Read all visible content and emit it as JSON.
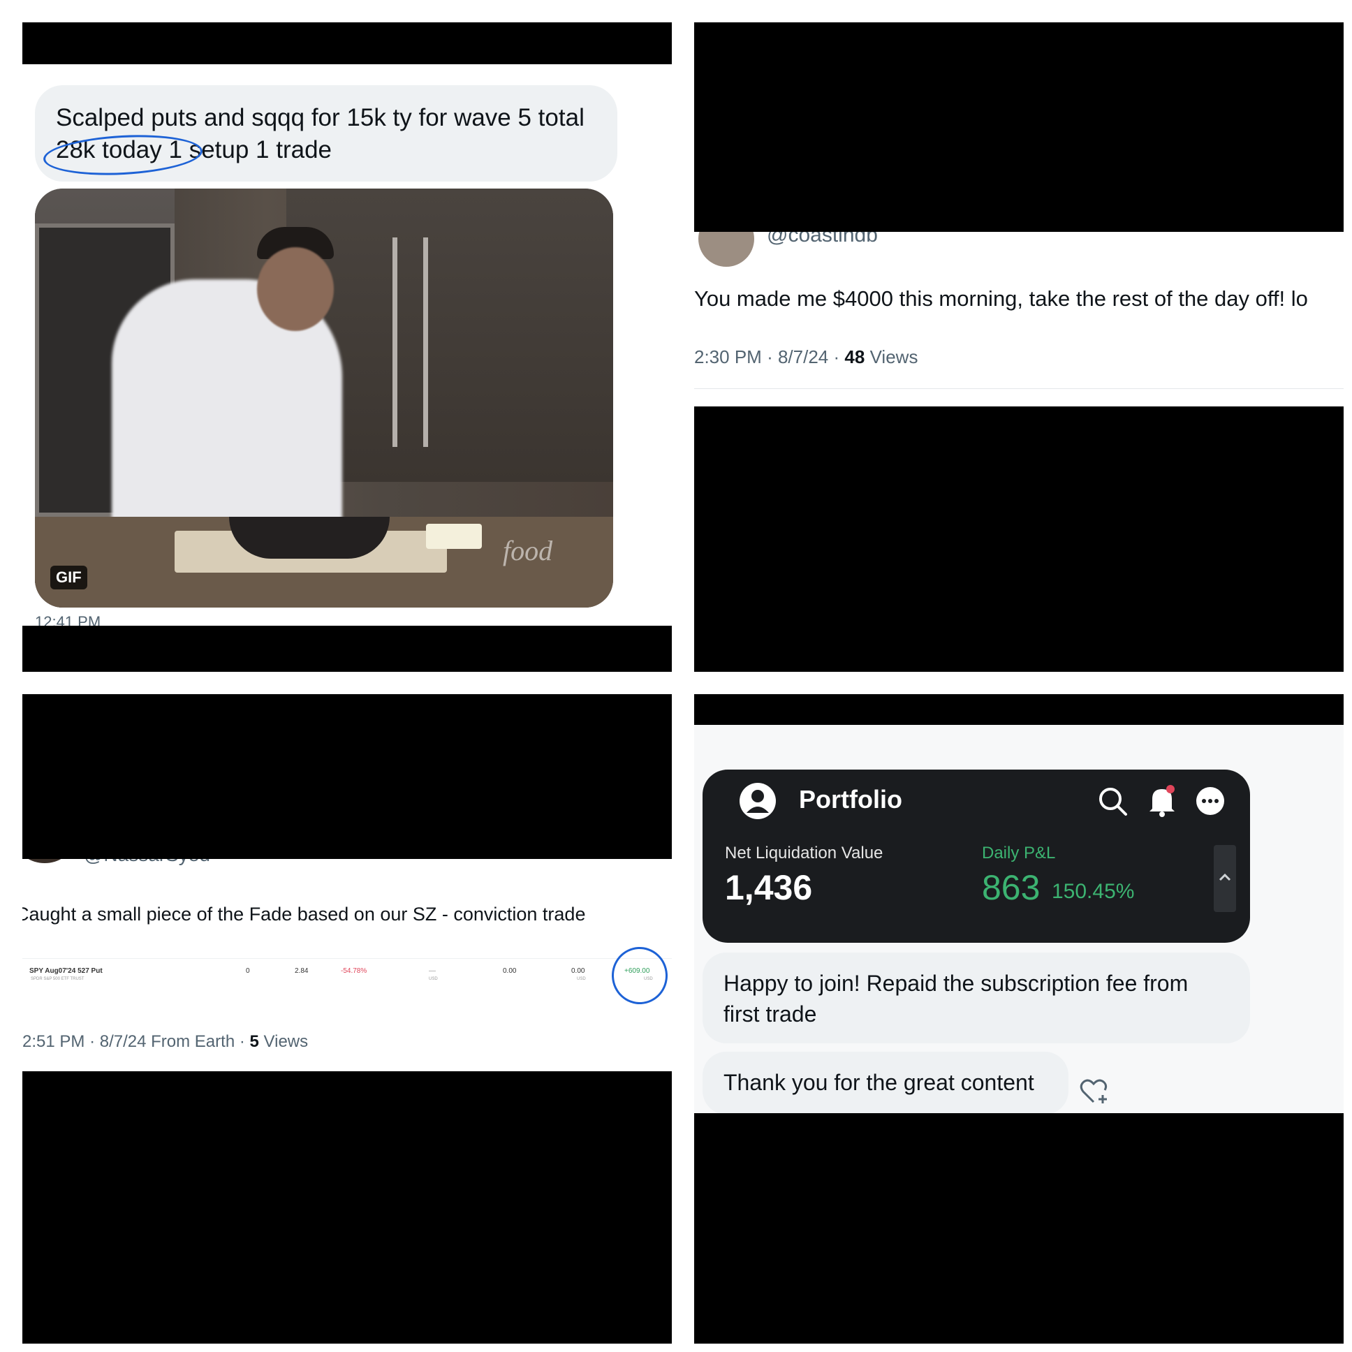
{
  "panel_1": {
    "message": {
      "line_1": "Scalped puts and sqqq for 15k ty for wave 5 total",
      "line_2": "28k today 1 setup 1 trade"
    },
    "gif": {
      "badge": "GIF",
      "watermark": "food"
    },
    "timestamp_partial": "12:41 PM"
  },
  "panel_2": {
    "handle_partial": "@coastindb",
    "reply_text": "You made me $4000 this morning, take the rest of the day off! lo",
    "time": "2:30 PM",
    "date": "8/7/24",
    "separator": "·",
    "views_count": "48",
    "views_label": "Views"
  },
  "panel_3": {
    "handle_partial": "@NassarSyed",
    "post_text": "Caught a small piece of the Fade based on our SZ - conviction trade",
    "position": {
      "symbol": "SPY Aug07'24 527 Put",
      "description": "SPDR S&P 500 ETF TRUST",
      "qty": "0",
      "price": "2.84",
      "change": "-54.78%",
      "col_dash": "—",
      "col_dash_unit": "USD",
      "col_a": "0.00",
      "col_b": "0.00",
      "col_b_unit": "USD",
      "pnl": "+609.00",
      "pnl_unit": "USD"
    },
    "time": "2:51 PM",
    "date": "8/7/24",
    "source": "From Earth",
    "separator": "·",
    "views_count": "5",
    "views_label": "Views"
  },
  "panel_4": {
    "app": {
      "title": "Portfolio",
      "net_liquidation_label": "Net Liquidation Value",
      "net_liquidation_value": "1,436",
      "daily_pnl_label": "Daily P&L",
      "daily_pnl_value": "863",
      "daily_pnl_percent": "150.45%"
    },
    "messages": [
      {
        "line_1": "Happy to join! Repaid the subscription fee from",
        "line_2": "first trade"
      },
      {
        "text": "Thank you for the great content"
      }
    ],
    "icons": [
      "account-icon",
      "search-icon",
      "bell-icon",
      "more-icon",
      "chevron-up-icon",
      "heart-plus-icon"
    ]
  },
  "colors": {
    "redaction": "#000000",
    "bubble": "#eef1f3",
    "annotation_circle": "#1d62d6",
    "positive_green": "#3cb371",
    "negative_red": "#e0455a",
    "muted_text": "#536471"
  }
}
